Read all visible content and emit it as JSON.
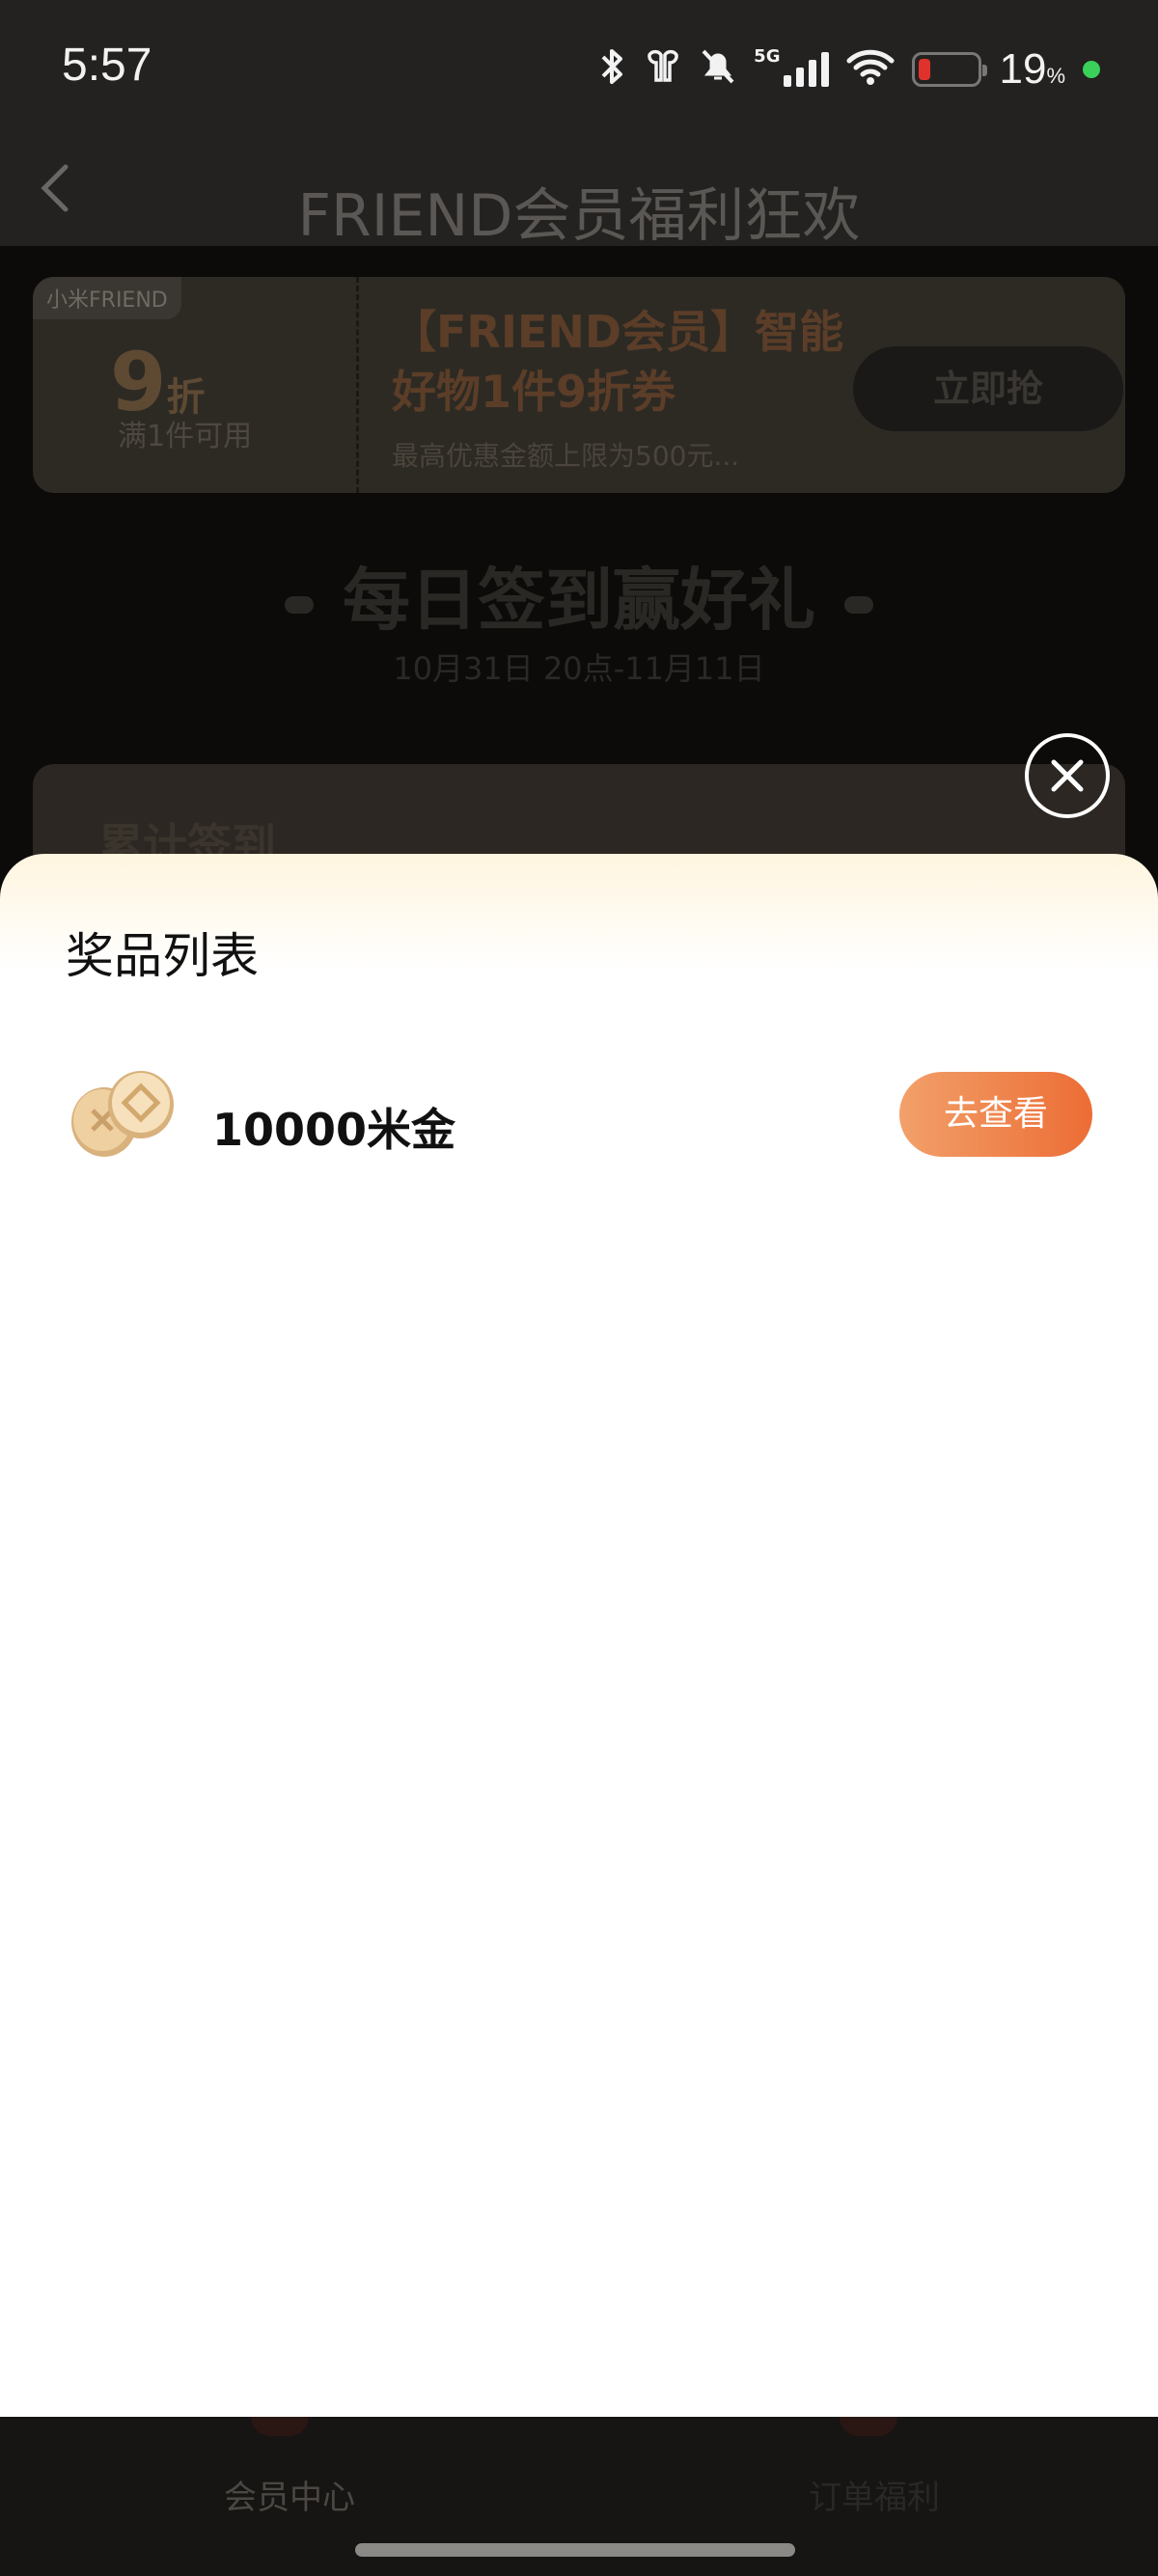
{
  "status_bar": {
    "time": "5:57",
    "network_label": "5G",
    "battery_percent": "19",
    "battery_unit": "%",
    "battery_level": 0.19,
    "icons": [
      "bluetooth-icon",
      "earbuds-icon",
      "mute-icon",
      "signal-icon",
      "wifi-icon",
      "battery-icon"
    ]
  },
  "header": {
    "title": "FRIEND会员福利狂欢",
    "back_icon": "chevron-left-icon"
  },
  "coupon": {
    "tag": "小米FRIEND",
    "discount": "9",
    "discount_unit": "折",
    "condition": "满1件可用",
    "title": "【FRIEND会员】智能好物1件9折券",
    "description": "最高优惠金额上限为500元...",
    "button_label": "立即抢"
  },
  "checkin": {
    "title": "每日签到赢好礼",
    "date_range": "10月31日 20点-11月11日",
    "card_label": "累计签到"
  },
  "sheet": {
    "title": "奖品列表",
    "prizes": [
      {
        "name": "10000米金",
        "button_label": "去查看",
        "icon": "coins-icon"
      }
    ]
  },
  "tabbar": {
    "tabs": [
      {
        "label": "会员中心"
      },
      {
        "label": "订单福利"
      }
    ]
  },
  "colors": {
    "accent_start": "#f2a06a",
    "accent_end": "#ec6d35",
    "sheet_header_tint": "#fff5df"
  }
}
